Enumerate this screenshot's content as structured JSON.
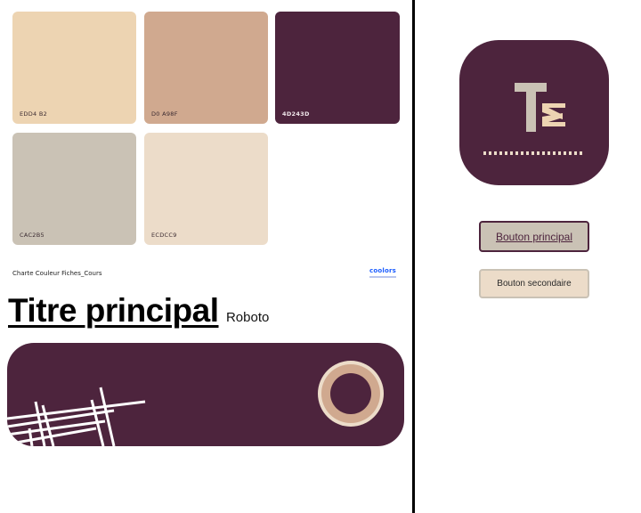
{
  "palette": {
    "swatches": [
      {
        "code": "EDD4 B2",
        "color": "#edd4b2"
      },
      {
        "code": "D0 A98F",
        "color": "#d0a98f"
      },
      {
        "code": "4D243D",
        "color": "#4d243d"
      },
      {
        "code": "CAC2B5",
        "color": "#cac2b5"
      },
      {
        "code": "ECDCC9",
        "color": "#ecdcc9"
      }
    ],
    "caption": "Charte Couleur Fiches_Cours",
    "brand": "coolors"
  },
  "typography": {
    "title": "Titre principal",
    "font_label": "Roboto"
  },
  "app_icon": {
    "letters": "TИ",
    "background": "#4d243d",
    "foreground": "#cac2b5",
    "accent": "#edd4b2"
  },
  "buttons": {
    "primary_label": "Bouton principal",
    "primary_bg": "#cac2b5",
    "secondary_label": "Bouton secondaire",
    "secondary_bg": "#ecdcc9"
  },
  "colors": {
    "accent": "#4d243d",
    "ring_outer": "#ecdcc9",
    "ring_inner": "#d0a98f"
  }
}
